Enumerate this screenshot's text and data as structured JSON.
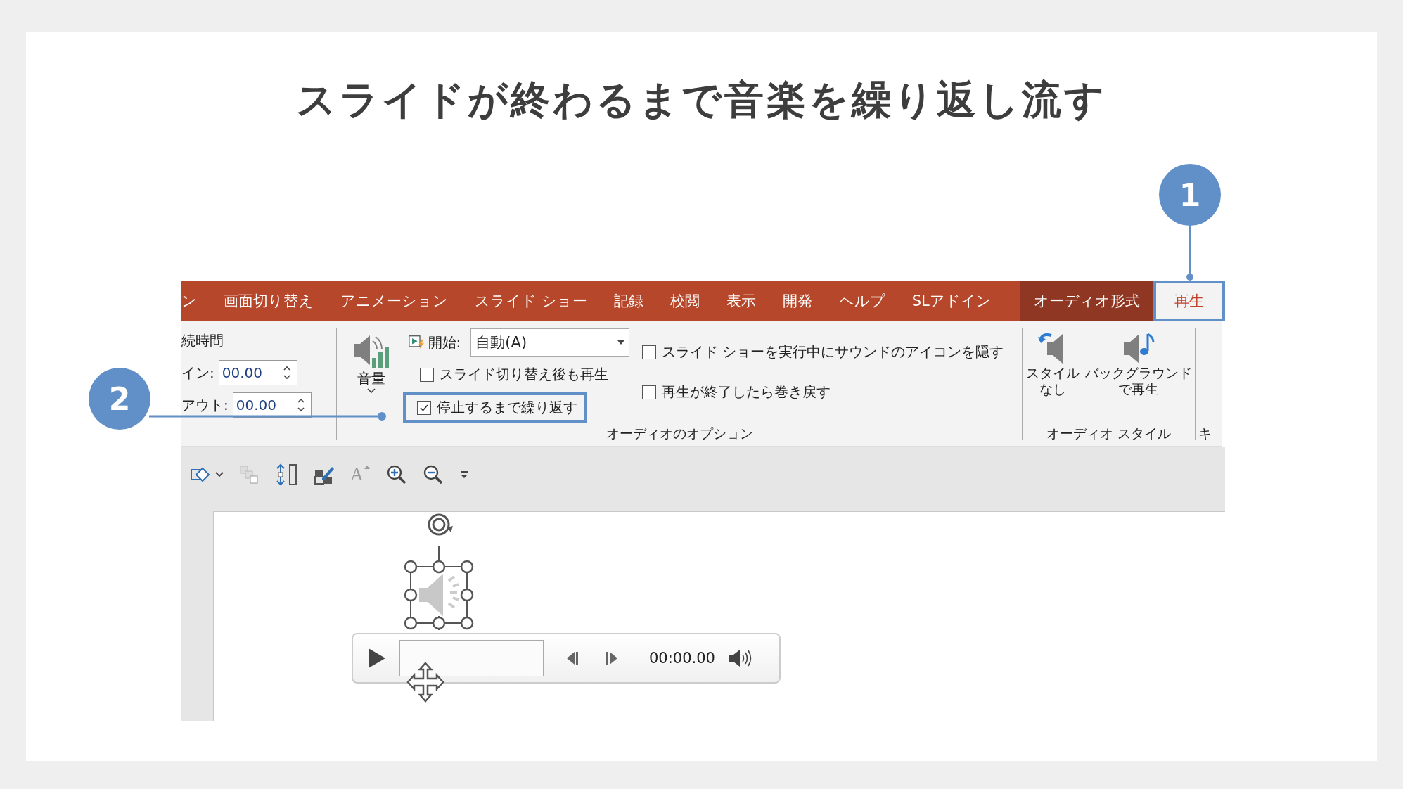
{
  "title": "スライドが終わるまで音楽を繰り返し流す",
  "callouts": [
    {
      "number": "1"
    },
    {
      "number": "2"
    }
  ],
  "tabs": [
    {
      "label": "ン",
      "selected": false,
      "contextual": false,
      "highlighted": false
    },
    {
      "label": "画面切り替え",
      "selected": false,
      "contextual": false,
      "highlighted": false
    },
    {
      "label": "アニメーション",
      "selected": false,
      "contextual": false,
      "highlighted": false
    },
    {
      "label": "スライド ショー",
      "selected": false,
      "contextual": false,
      "highlighted": false
    },
    {
      "label": "記録",
      "selected": false,
      "contextual": false,
      "highlighted": false
    },
    {
      "label": "校閲",
      "selected": false,
      "contextual": false,
      "highlighted": false
    },
    {
      "label": "表示",
      "selected": false,
      "contextual": false,
      "highlighted": false
    },
    {
      "label": "開発",
      "selected": false,
      "contextual": false,
      "highlighted": false
    },
    {
      "label": "ヘルプ",
      "selected": false,
      "contextual": false,
      "highlighted": false
    },
    {
      "label": "SLアドイン",
      "selected": false,
      "contextual": false,
      "highlighted": false
    },
    {
      "label": "オーディオ形式",
      "selected": false,
      "contextual": true,
      "highlighted": false
    },
    {
      "label": "再生",
      "selected": true,
      "contextual": true,
      "highlighted": true
    }
  ],
  "timing_group": {
    "heading": "続時間",
    "fields": [
      {
        "label": "イン:",
        "value": "00.00"
      },
      {
        "label": "アウト:",
        "value": "00.00"
      }
    ]
  },
  "options_group": {
    "volume_label": "音量",
    "start_label": "開始:",
    "start_value": "自動(A)",
    "group_label": "オーディオのオプション",
    "checkboxes": [
      {
        "label": "スライド切り替え後も再生",
        "checked": false,
        "highlighted": false
      },
      {
        "label": "停止するまで繰り返す",
        "checked": true,
        "highlighted": true
      },
      {
        "label": "スライド ショーを実行中にサウンドのアイコンを隠す",
        "checked": false,
        "highlighted": false
      },
      {
        "label": "再生が終了したら巻き戻す",
        "checked": false,
        "highlighted": false
      }
    ]
  },
  "styles_group": {
    "group_label": "オーディオ スタイル",
    "buttons": [
      {
        "kind": "no-style",
        "lines": [
          "スタイル",
          "なし"
        ]
      },
      {
        "kind": "background",
        "lines": [
          "バックグラウンド",
          "で再生"
        ]
      }
    ]
  },
  "next_group_label": "キ",
  "toolbar": [
    {
      "kind": "shape"
    },
    {
      "kind": "caret"
    },
    {
      "kind": "arrange"
    },
    {
      "kind": "height"
    },
    {
      "kind": "edit"
    },
    {
      "kind": "font",
      "label": "A"
    },
    {
      "kind": "zoom-in"
    },
    {
      "kind": "zoom-out"
    },
    {
      "kind": "more"
    }
  ],
  "player": {
    "time": "00:00.00"
  }
}
